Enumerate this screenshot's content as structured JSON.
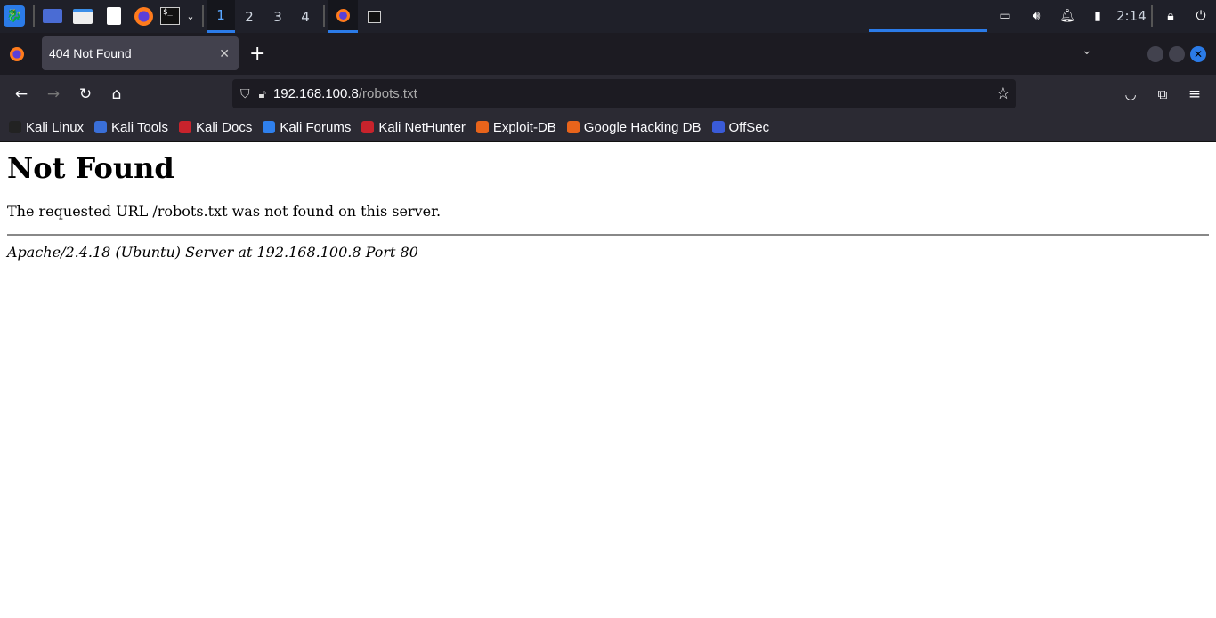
{
  "taskbar": {
    "workspaces": [
      "1",
      "2",
      "3",
      "4"
    ],
    "active_workspace": "1",
    "clock": "2:14",
    "accent": "#2b7be8"
  },
  "browser": {
    "tab_title": "404 Not Found",
    "url_host": "192.168.100.8",
    "url_path": "/robots.txt",
    "bookmarks": [
      {
        "label": "Kali Linux",
        "color": "#222"
      },
      {
        "label": "Kali Tools",
        "color": "#3a6fd8"
      },
      {
        "label": "Kali Docs",
        "color": "#c8232c"
      },
      {
        "label": "Kali Forums",
        "color": "#2f80ed"
      },
      {
        "label": "Kali NetHunter",
        "color": "#c8232c"
      },
      {
        "label": "Exploit-DB",
        "color": "#e8641b"
      },
      {
        "label": "Google Hacking DB",
        "color": "#e8641b"
      },
      {
        "label": "OffSec",
        "color": "#3a5bd8"
      }
    ]
  },
  "page": {
    "heading": "Not Found",
    "message": "The requested URL /robots.txt was not found on this server.",
    "footer": "Apache/2.4.18 (Ubuntu) Server at 192.168.100.8 Port 80"
  }
}
